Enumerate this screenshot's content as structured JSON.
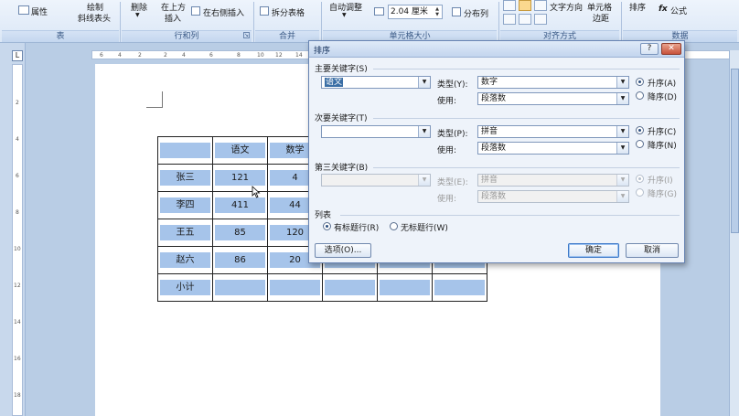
{
  "ribbon": {
    "properties": "属性",
    "draw_table_line1": "绘制",
    "draw_table_line2": "斜线表头",
    "delete": "删除",
    "insert_above_line1": "在上方",
    "insert_above_line2": "插入",
    "insert_right": "在右侧插入",
    "split_table": "拆分表格",
    "autofit": "自动调整",
    "row_height": "2.04 厘米",
    "distribute_cols": "分布列",
    "text_direction": "文字方向",
    "cell_margin_line1": "单元格",
    "cell_margin_line2": "边距",
    "sort": "排序",
    "formula": "公式",
    "groups": {
      "table": "表",
      "rows_cols": "行和列",
      "merge": "合并",
      "cell_size": "单元格大小",
      "alignment": "对齐方式",
      "data": "数据"
    }
  },
  "ruler": {
    "corner": "L",
    "h_ticks": [
      "6",
      "4",
      "2",
      "2",
      "4",
      "6",
      "8",
      "10",
      "12",
      "14"
    ],
    "v_ticks": [
      "2",
      "4",
      "6",
      "8",
      "10",
      "12",
      "14",
      "16",
      "18"
    ]
  },
  "table": {
    "header": [
      "",
      "语文",
      "数学"
    ],
    "rows": [
      {
        "name": "张三",
        "chinese": "121",
        "math": "4"
      },
      {
        "name": "李四",
        "chinese": "411",
        "math": "44"
      },
      {
        "name": "王五",
        "chinese": "85",
        "math": "120"
      },
      {
        "name": "赵六",
        "chinese": "86",
        "math": "20"
      },
      {
        "name": "小计",
        "chinese": "",
        "math": ""
      }
    ]
  },
  "dialog": {
    "title": "排序",
    "help": "?",
    "close": "✕",
    "primary": {
      "section": "主要关键字(S)",
      "key": "语文",
      "type_label": "类型(Y):",
      "type_value": "数字",
      "using_label": "使用:",
      "using_value": "段落数",
      "asc": "升序(A)",
      "desc": "降序(D)"
    },
    "secondary": {
      "section": "次要关键字(T)",
      "key": "",
      "type_label": "类型(P):",
      "type_value": "拼音",
      "using_label": "使用:",
      "using_value": "段落数",
      "asc": "升序(C)",
      "desc": "降序(N)"
    },
    "tertiary": {
      "section": "第三关键字(B)",
      "key": "",
      "type_label": "类型(E):",
      "type_value": "拼音",
      "using_label": "使用:",
      "using_value": "段落数",
      "asc": "升序(I)",
      "desc": "降序(G)"
    },
    "list": {
      "section": "列表",
      "has_header": "有标题行(R)",
      "no_header": "无标题行(W)"
    },
    "options_btn": "选项(O)...",
    "ok_btn": "确定",
    "cancel_btn": "取消"
  }
}
